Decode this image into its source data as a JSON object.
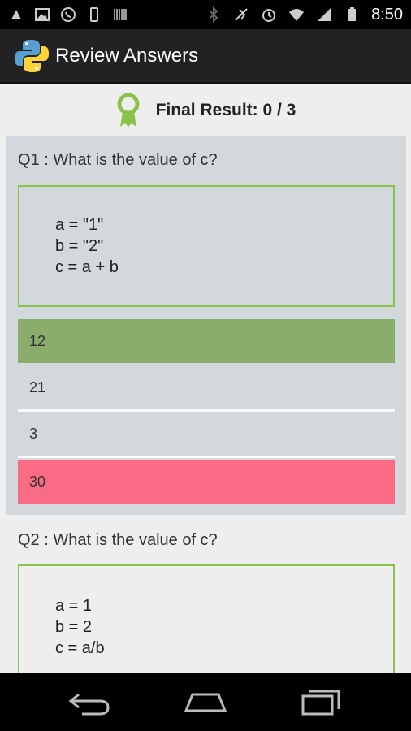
{
  "status_bar": {
    "time": "8:50",
    "icons": [
      "usb-debug-icon",
      "image-icon",
      "whatsapp-icon",
      "phone-icon",
      "barcode-icon",
      "bluetooth-icon",
      "mute-icon",
      "alarm-icon",
      "wifi-icon",
      "signal-icon",
      "battery-icon"
    ]
  },
  "action_bar": {
    "title": "Review Answers",
    "logo": "python-logo"
  },
  "result": {
    "label": "Final Result: 0 / 3",
    "icon": "ribbon-award-icon"
  },
  "questions": [
    {
      "title": "Q1 : What is the value of c?",
      "code": [
        "a = \"1\"",
        "b = \"2\"",
        "c = a + b"
      ],
      "options": [
        {
          "label": "12",
          "state": "correct"
        },
        {
          "label": "21",
          "state": "neutral"
        },
        {
          "label": "3",
          "state": "neutral"
        },
        {
          "label": "30",
          "state": "wrong"
        }
      ]
    },
    {
      "title": "Q2 : What is the value of c?",
      "code": [
        "a = 1",
        "b = 2",
        "c = a/b"
      ],
      "options": []
    }
  ],
  "colors": {
    "correct": "#8aad6b",
    "wrong": "#fa6b86",
    "card": "#d2d8dc",
    "code_border": "#8bc34a",
    "action_bar": "#222222"
  },
  "nav": [
    "back-icon",
    "home-icon",
    "recent-apps-icon"
  ]
}
